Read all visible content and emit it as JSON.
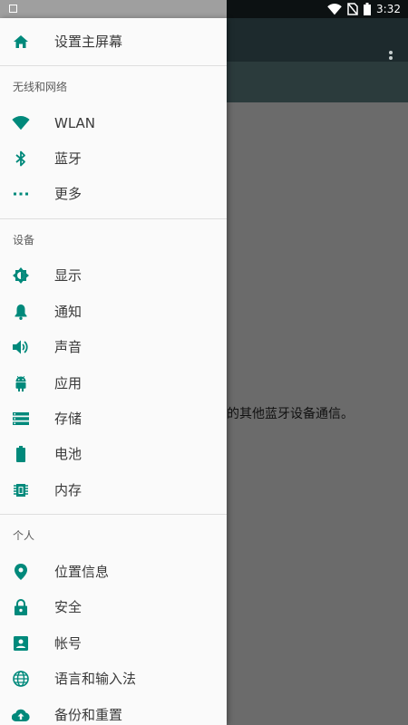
{
  "status_bar": {
    "time": "3:32"
  },
  "background": {
    "text": "近的其他蓝牙设备通信。"
  },
  "drawer": {
    "home": {
      "label": "设置主屏幕",
      "icon": "home-icon"
    },
    "sections": [
      {
        "title": "无线和网络",
        "items": [
          {
            "label": "WLAN",
            "icon": "wifi-icon"
          },
          {
            "label": "蓝牙",
            "icon": "bluetooth-icon"
          },
          {
            "label": "更多",
            "icon": "more-dots-icon"
          }
        ]
      },
      {
        "title": "设备",
        "items": [
          {
            "label": "显示",
            "icon": "brightness-icon"
          },
          {
            "label": "通知",
            "icon": "bell-icon"
          },
          {
            "label": "声音",
            "icon": "volume-icon"
          },
          {
            "label": "应用",
            "icon": "android-icon"
          },
          {
            "label": "存储",
            "icon": "storage-icon"
          },
          {
            "label": "电池",
            "icon": "battery-icon"
          },
          {
            "label": "内存",
            "icon": "memory-icon"
          }
        ]
      },
      {
        "title": "个人",
        "items": [
          {
            "label": "位置信息",
            "icon": "location-icon"
          },
          {
            "label": "安全",
            "icon": "lock-icon"
          },
          {
            "label": "帐号",
            "icon": "account-icon"
          },
          {
            "label": "语言和输入法",
            "icon": "globe-icon"
          },
          {
            "label": "备份和重置",
            "icon": "cloud-upload-icon"
          }
        ]
      }
    ]
  },
  "colors": {
    "accent": "#00897b",
    "drawer_bg": "#fafafa",
    "scrim": "#6b6b6b"
  }
}
